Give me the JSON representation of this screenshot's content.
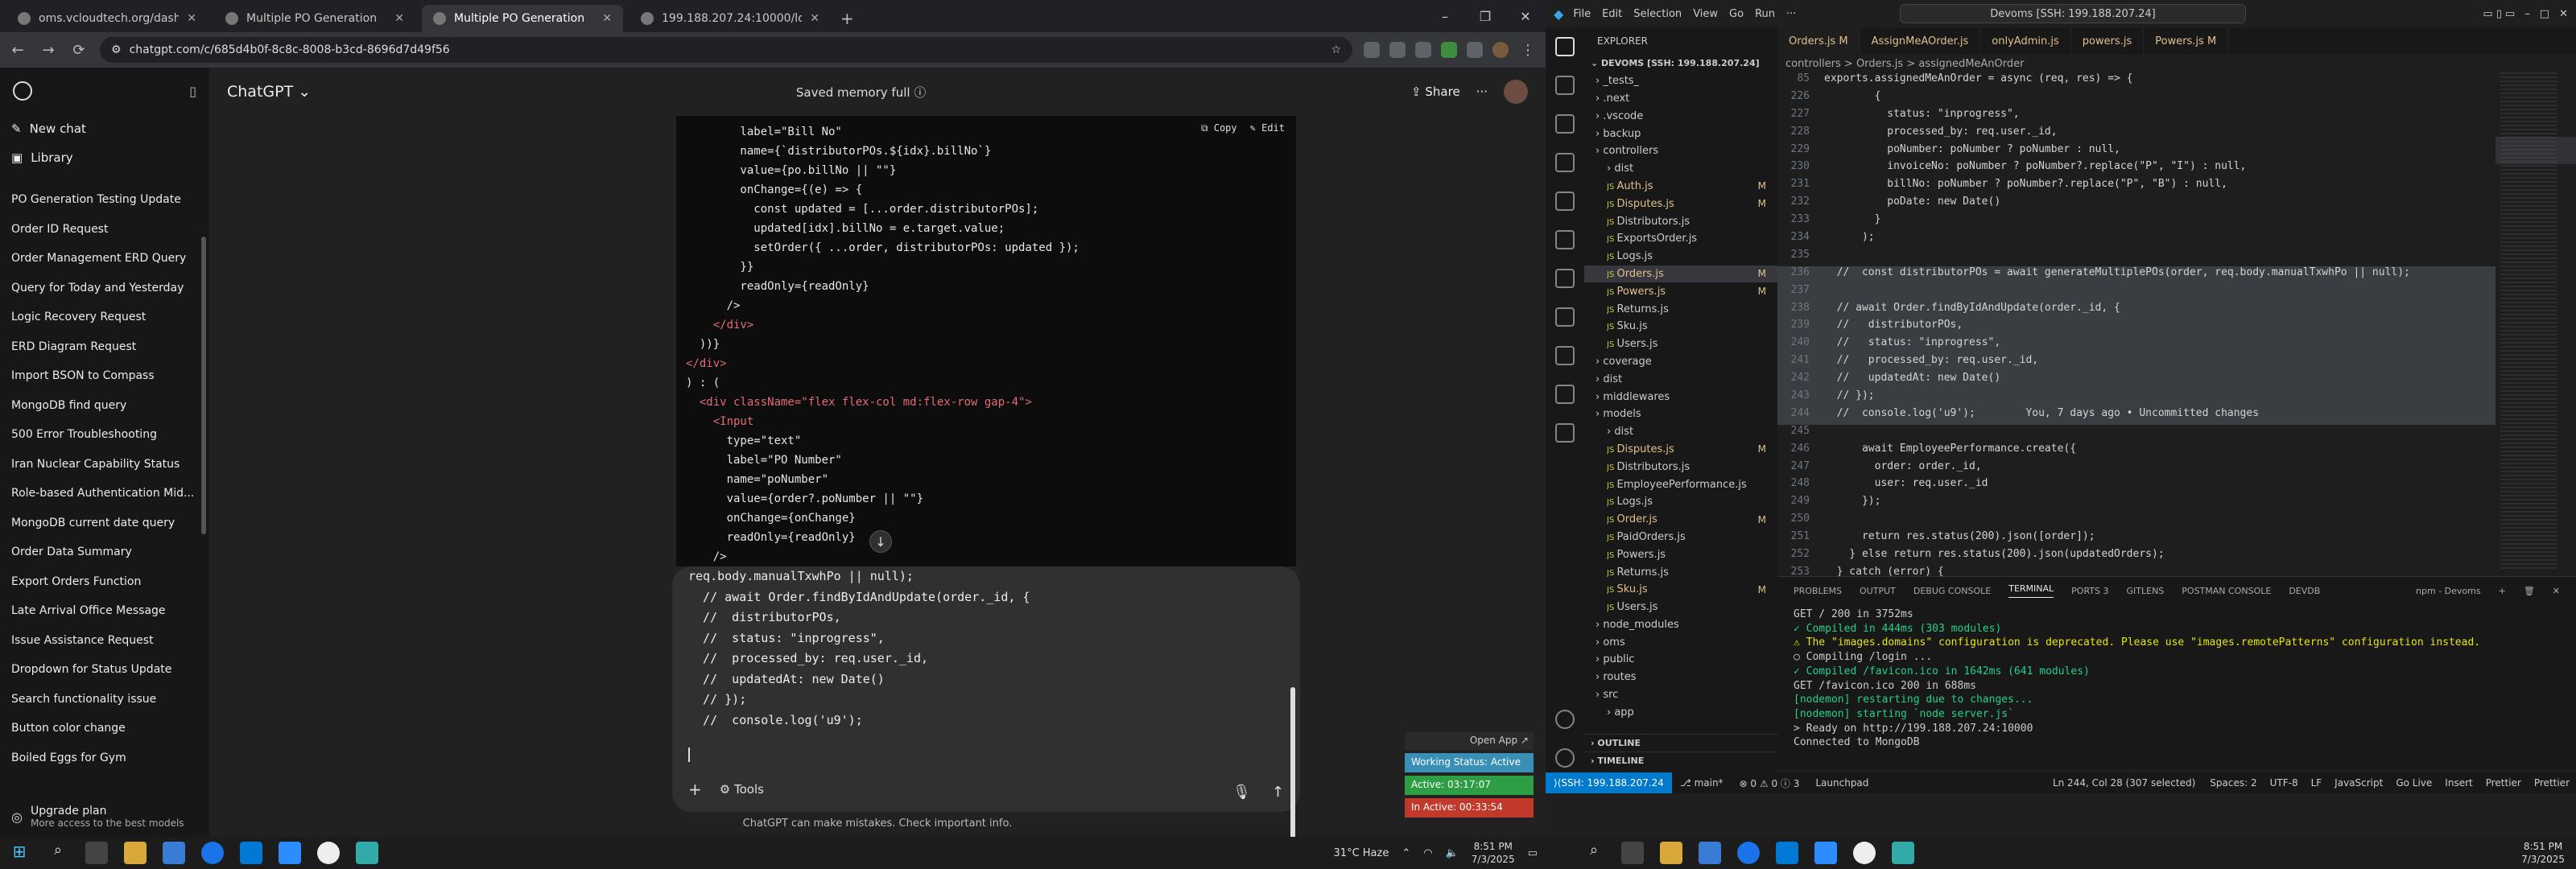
{
  "browser": {
    "tabs": [
      {
        "title": "oms.vcloudtech.org/dashboard",
        "active": false
      },
      {
        "title": "Multiple PO Generation",
        "active": false
      },
      {
        "title": "Multiple PO Generation",
        "active": true
      },
      {
        "title": "199.188.207.24:10000/login",
        "active": false
      }
    ],
    "url": "chatgpt.com/c/685d4b0f-8c8c-8008-b3cd-8696d7d49f56"
  },
  "chatgpt": {
    "sidebar": {
      "new_chat": "New chat",
      "library": "Library",
      "chats": [
        "PO Generation Testing Update",
        "Order ID Request",
        "Order Management ERD Query",
        "Query for Today and Yesterday",
        "Logic Recovery Request",
        "ERD Diagram Request",
        "Import BSON to Compass",
        "MongoDB find query",
        "500 Error Troubleshooting",
        "Iran Nuclear Capability Status",
        "Role-based Authentication Mid...",
        "MongoDB current date query",
        "Order Data Summary",
        "Export Orders Function",
        "Late Arrival Office Message",
        "Issue Assistance Request",
        "Dropdown for Status Update",
        "Search functionality issue",
        "Button color change",
        "Boiled Eggs for Gym"
      ],
      "upgrade_title": "Upgrade plan",
      "upgrade_sub": "More access to the best models"
    },
    "header": {
      "model": "ChatGPT",
      "memory": "Saved memory full",
      "share": "Share"
    },
    "code_actions": {
      "copy": "Copy",
      "edit": "Edit"
    },
    "code_lines": [
      "        label=\"Bill No\"",
      "        name={`distributorPOs.${idx}.billNo`}",
      "        value={po.billNo || \"\"}",
      "        onChange={(e) => {",
      "          const updated = [...order.distributorPOs];",
      "          updated[idx].billNo = e.target.value;",
      "          setOrder({ ...order, distributorPOs: updated });",
      "        }}",
      "        readOnly={readOnly}",
      "      />",
      "    </div>",
      "  ))}",
      "</div>",
      ") : (",
      "  <div className=\"flex flex-col md:flex-row gap-4\">",
      "    <Input",
      "      type=\"text\"",
      "      label=\"PO Number\"",
      "      name=\"poNumber\"",
      "      value={order?.poNumber || \"\"}",
      "      onChange={onChange}",
      "      readOnly={readOnly}",
      "    />",
      "    <Input"
    ],
    "composer_lines": [
      "req.body.manualTxwhPo || null);",
      "  // await Order.findByIdAndUpdate(order._id, {",
      "  //  distributorPOs,",
      "  //  status: \"inprogress\",",
      "  //  processed_by: req.user._id,",
      "  //  updatedAt: new Date()",
      "  // });",
      "  //  console.log('u9');"
    ],
    "tools_label": "Tools",
    "disclaimer": "ChatGPT can make mistakes. Check important info."
  },
  "widget": {
    "open_app": "Open App ↗",
    "working_status": "Working Status: Active",
    "active": "Active: 03:17:07",
    "inactive": "In Active: 00:33:54"
  },
  "win_taskbar_left": {
    "weather": "31°C  Haze",
    "time": "8:51 PM",
    "date": "7/3/2025"
  },
  "vscode": {
    "menu": [
      "File",
      "Edit",
      "Selection",
      "View",
      "Go",
      "Run",
      "···"
    ],
    "search": "Devoms [SSH: 199.188.207.24]",
    "explorer_title": "EXPLORER",
    "workspace": "DEVOMS [SSH: 199.188.207.24]",
    "tree": [
      {
        "name": "_tests_",
        "depth": 1,
        "folder": true,
        "mark": ""
      },
      {
        "name": ".next",
        "depth": 1,
        "folder": true,
        "mark": ""
      },
      {
        "name": ".vscode",
        "depth": 1,
        "folder": true,
        "mark": ""
      },
      {
        "name": "backup",
        "depth": 1,
        "folder": true,
        "mark": ""
      },
      {
        "name": "controllers",
        "depth": 1,
        "folder": true,
        "mark": ""
      },
      {
        "name": "dist",
        "depth": 2,
        "folder": true,
        "mark": ""
      },
      {
        "name": "Auth.js",
        "depth": 2,
        "folder": false,
        "mark": "M"
      },
      {
        "name": "Disputes.js",
        "depth": 2,
        "folder": false,
        "mark": "M"
      },
      {
        "name": "Distributors.js",
        "depth": 2,
        "folder": false,
        "mark": ""
      },
      {
        "name": "ExportsOrder.js",
        "depth": 2,
        "folder": false,
        "mark": ""
      },
      {
        "name": "Logs.js",
        "depth": 2,
        "folder": false,
        "mark": ""
      },
      {
        "name": "Orders.js",
        "depth": 2,
        "folder": false,
        "mark": "M",
        "selected": true
      },
      {
        "name": "Powers.js",
        "depth": 2,
        "folder": false,
        "mark": "M"
      },
      {
        "name": "Returns.js",
        "depth": 2,
        "folder": false,
        "mark": ""
      },
      {
        "name": "Sku.js",
        "depth": 2,
        "folder": false,
        "mark": ""
      },
      {
        "name": "Users.js",
        "depth": 2,
        "folder": false,
        "mark": ""
      },
      {
        "name": "coverage",
        "depth": 1,
        "folder": true,
        "mark": ""
      },
      {
        "name": "dist",
        "depth": 1,
        "folder": true,
        "mark": ""
      },
      {
        "name": "middlewares",
        "depth": 1,
        "folder": true,
        "mark": ""
      },
      {
        "name": "models",
        "depth": 1,
        "folder": true,
        "mark": ""
      },
      {
        "name": "dist",
        "depth": 2,
        "folder": true,
        "mark": ""
      },
      {
        "name": "Disputes.js",
        "depth": 2,
        "folder": false,
        "mark": "M"
      },
      {
        "name": "Distributors.js",
        "depth": 2,
        "folder": false,
        "mark": ""
      },
      {
        "name": "EmployeePerformance.js",
        "depth": 2,
        "folder": false,
        "mark": ""
      },
      {
        "name": "Logs.js",
        "depth": 2,
        "folder": false,
        "mark": ""
      },
      {
        "name": "Order.js",
        "depth": 2,
        "folder": false,
        "mark": "M"
      },
      {
        "name": "PaidOrders.js",
        "depth": 2,
        "folder": false,
        "mark": ""
      },
      {
        "name": "Powers.js",
        "depth": 2,
        "folder": false,
        "mark": ""
      },
      {
        "name": "Returns.js",
        "depth": 2,
        "folder": false,
        "mark": ""
      },
      {
        "name": "Sku.js",
        "depth": 2,
        "folder": false,
        "mark": "M"
      },
      {
        "name": "Users.js",
        "depth": 2,
        "folder": false,
        "mark": ""
      },
      {
        "name": "node_modules",
        "depth": 1,
        "folder": true,
        "mark": ""
      },
      {
        "name": "oms",
        "depth": 1,
        "folder": true,
        "mark": ""
      },
      {
        "name": "public",
        "depth": 1,
        "folder": true,
        "mark": ""
      },
      {
        "name": "routes",
        "depth": 1,
        "folder": true,
        "mark": ""
      },
      {
        "name": "src",
        "depth": 1,
        "folder": true,
        "mark": ""
      },
      {
        "name": "app",
        "depth": 2,
        "folder": true,
        "mark": ""
      }
    ],
    "outline": "OUTLINE",
    "timeline": "TIMELINE",
    "editor_tabs": [
      "Orders.js M",
      "AssignMeAOrder.js",
      "onlyAdmin.js",
      "powers.js",
      "Powers.js M"
    ],
    "breadcrumb": "controllers > Orders.js > assignedMeAnOrder",
    "sticky": "exports.assignedMeAnOrder = async (req, res) => {",
    "editor_lines": [
      {
        "n": "85",
        "t": "exports.assignedMeAnOrder = async (req, res) => {",
        "c": "normal"
      },
      {
        "n": "226",
        "t": "        {",
        "c": "normal"
      },
      {
        "n": "227",
        "t": "          status: \"inprogress\",",
        "c": "normal"
      },
      {
        "n": "228",
        "t": "          processed_by: req.user._id,",
        "c": "normal"
      },
      {
        "n": "229",
        "t": "          poNumber: poNumber ? poNumber : null,",
        "c": "normal"
      },
      {
        "n": "230",
        "t": "          invoiceNo: poNumber ? poNumber?.replace(\"P\", \"I\") : null,",
        "c": "normal"
      },
      {
        "n": "231",
        "t": "          billNo: poNumber ? poNumber?.replace(\"P\", \"B\") : null,",
        "c": "normal"
      },
      {
        "n": "232",
        "t": "          poDate: new Date()",
        "c": "normal"
      },
      {
        "n": "233",
        "t": "        }",
        "c": "normal"
      },
      {
        "n": "234",
        "t": "      );",
        "c": "normal"
      },
      {
        "n": "235",
        "t": "",
        "c": "normal"
      },
      {
        "n": "236",
        "t": "  //  const distributorPOs = await generateMultiplePOs(order, req.body.manualTxwhPo || null);",
        "c": "hl"
      },
      {
        "n": "237",
        "t": "",
        "c": "hl"
      },
      {
        "n": "238",
        "t": "  // await Order.findByIdAndUpdate(order._id, {",
        "c": "hl"
      },
      {
        "n": "239",
        "t": "  //   distributorPOs,",
        "c": "hl"
      },
      {
        "n": "240",
        "t": "  //   status: \"inprogress\",",
        "c": "hl"
      },
      {
        "n": "241",
        "t": "  //   processed_by: req.user._id,",
        "c": "hl"
      },
      {
        "n": "242",
        "t": "  //   updatedAt: new Date()",
        "c": "hl"
      },
      {
        "n": "243",
        "t": "  // });",
        "c": "hl"
      },
      {
        "n": "244",
        "t": "  //  console.log('u9');        You, 7 days ago • Uncommitted changes",
        "c": "hl"
      },
      {
        "n": "245",
        "t": "",
        "c": "normal"
      },
      {
        "n": "246",
        "t": "      await EmployeePerformance.create({",
        "c": "normal"
      },
      {
        "n": "247",
        "t": "        order: order._id,",
        "c": "normal"
      },
      {
        "n": "248",
        "t": "        user: req.user._id",
        "c": "normal"
      },
      {
        "n": "249",
        "t": "      });",
        "c": "normal"
      },
      {
        "n": "250",
        "t": "",
        "c": "normal"
      },
      {
        "n": "251",
        "t": "      return res.status(200).json([order]);",
        "c": "normal"
      },
      {
        "n": "252",
        "t": "    } else return res.status(200).json(updatedOrders);",
        "c": "normal"
      },
      {
        "n": "253",
        "t": "  } catch (error) {",
        "c": "normal"
      },
      {
        "n": "254",
        "t": "    console.error(error);",
        "c": "normal"
      },
      {
        "n": "255",
        "t": "    return res",
        "c": "normal"
      },
      {
        "n": "256",
        "t": "      .status(500)",
        "c": "normal"
      }
    ],
    "panel_tabs": [
      "PROBLEMS",
      "OUTPUT",
      "DEBUG CONSOLE",
      "TERMINAL",
      "PORTS 3",
      "GITLENS",
      "POSTMAN CONSOLE",
      "DEVDB"
    ],
    "terminal_label": "npm - Devoms",
    "terminal_lines": [
      {
        "t": "GET / 200 in 3752ms",
        "c": ""
      },
      {
        "t": "✓ Compiled in 444ms (303 modules)",
        "c": "gr"
      },
      {
        "t": "⚠ The \"images.domains\" configuration is deprecated. Please use \"images.remotePatterns\" configuration instead.",
        "c": "yw"
      },
      {
        "t": "○ Compiling /login ...",
        "c": ""
      },
      {
        "t": "✓ Compiled /favicon.ico in 1642ms (641 modules)",
        "c": "gr"
      },
      {
        "t": "GET /favicon.ico 200 in 688ms",
        "c": ""
      },
      {
        "t": "[nodemon] restarting due to changes...",
        "c": "gr"
      },
      {
        "t": "[nodemon] starting `node server.js`",
        "c": "gr"
      },
      {
        "t": "> Ready on http://199.188.207.24:10000",
        "c": ""
      },
      {
        "t": "Connected to MongoDB",
        "c": ""
      }
    ],
    "status": {
      "remote": "SSH: 199.188.207.24",
      "branch": "main*",
      "problems": "⊗ 0 ⚠ 0 ⓘ 3",
      "launch": "Launchpad",
      "position": "Ln 244, Col 28 (307 selected)",
      "spaces": "Spaces: 2",
      "encoding": "UTF-8",
      "eol": "LF",
      "lang": "JavaScript",
      "golive": "Go Live",
      "insert": "Insert",
      "prettier": "Prettier"
    },
    "clock_time": "8:51 PM",
    "clock_date": "7/3/2025"
  }
}
